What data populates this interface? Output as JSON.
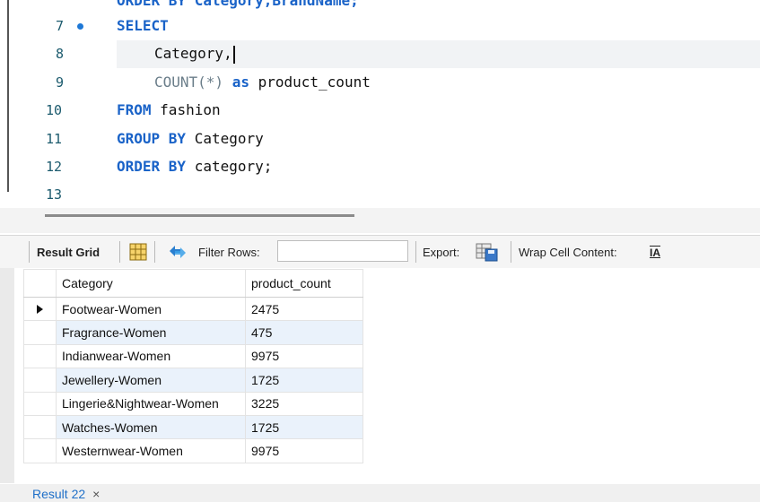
{
  "editor": {
    "partial_top_line": "ORDER BY Category,BrandName;",
    "lines": [
      {
        "num": "7"
      },
      {
        "num": "8"
      },
      {
        "num": "9"
      },
      {
        "num": "10"
      },
      {
        "num": "11"
      },
      {
        "num": "12"
      },
      {
        "num": "13"
      }
    ],
    "tokens": {
      "select": "SELECT",
      "category_col": "Category,",
      "count_fn": "COUNT(*)",
      "as_kw": "as",
      "alias": "product_count",
      "from_kw": "FROM",
      "table": "fashion",
      "group_by_kw": "GROUP BY",
      "group_col": "Category",
      "order_by_kw": "ORDER BY",
      "order_col": "category;"
    }
  },
  "toolbar": {
    "result_grid_label": "Result Grid",
    "filter_rows_label": "Filter Rows:",
    "filter_value": "",
    "export_label": "Export:",
    "wrap_label": "Wrap Cell Content:",
    "wrap_icon_glyph": "IA"
  },
  "grid": {
    "columns": [
      "Category",
      "product_count"
    ],
    "rows": [
      {
        "category": "Footwear-Women",
        "product_count": "2475"
      },
      {
        "category": "Fragrance-Women",
        "product_count": "475"
      },
      {
        "category": "Indianwear-Women",
        "product_count": "9975"
      },
      {
        "category": "Jewellery-Women",
        "product_count": "1725"
      },
      {
        "category": "Lingerie&Nightwear-Women",
        "product_count": "3225"
      },
      {
        "category": "Watches-Women",
        "product_count": "1725"
      },
      {
        "category": "Westernwear-Women",
        "product_count": "9975"
      }
    ]
  },
  "tabs": [
    {
      "label": "Result 22",
      "close": "×"
    }
  ],
  "colors": {
    "keyword": "#1a63c8",
    "line_number": "#1c5b6e",
    "row_alt": "#eaf2fb",
    "tab_text": "#1e6fc8"
  },
  "icons": [
    "breakpoint-dot-icon",
    "grid-layout-icon",
    "refresh-arrows-icon",
    "export-save-icon",
    "wrap-text-icon",
    "row-pointer-icon",
    "close-icon"
  ]
}
